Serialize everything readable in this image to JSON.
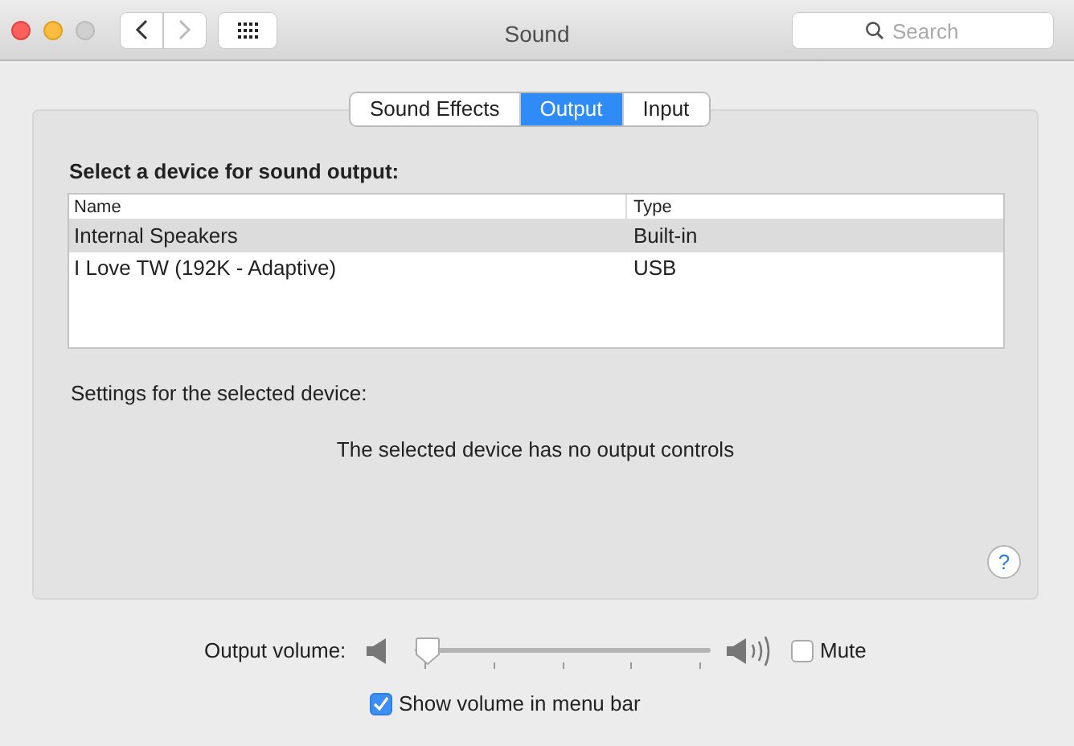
{
  "window": {
    "title": "Sound"
  },
  "search": {
    "placeholder": "Search"
  },
  "tabs": [
    {
      "label": "Sound Effects",
      "selected": false
    },
    {
      "label": "Output",
      "selected": true
    },
    {
      "label": "Input",
      "selected": false
    }
  ],
  "device_heading": "Select a device for sound output:",
  "table": {
    "columns": [
      "Name",
      "Type"
    ],
    "rows": [
      {
        "cells": [
          "Internal Speakers",
          "Built-in"
        ],
        "selected": true
      },
      {
        "cells": [
          "I Love TW (192K - Adaptive)",
          "USB"
        ],
        "selected": false
      }
    ]
  },
  "settings_label": "Settings for the selected device:",
  "message": "The selected device has no output controls",
  "help": "?",
  "volume": {
    "label": "Output volume:",
    "level": 0.0
  },
  "mute": {
    "label": "Mute",
    "checked": false
  },
  "show_in_menu_bar": {
    "label": "Show volume in menu bar",
    "checked": true
  }
}
